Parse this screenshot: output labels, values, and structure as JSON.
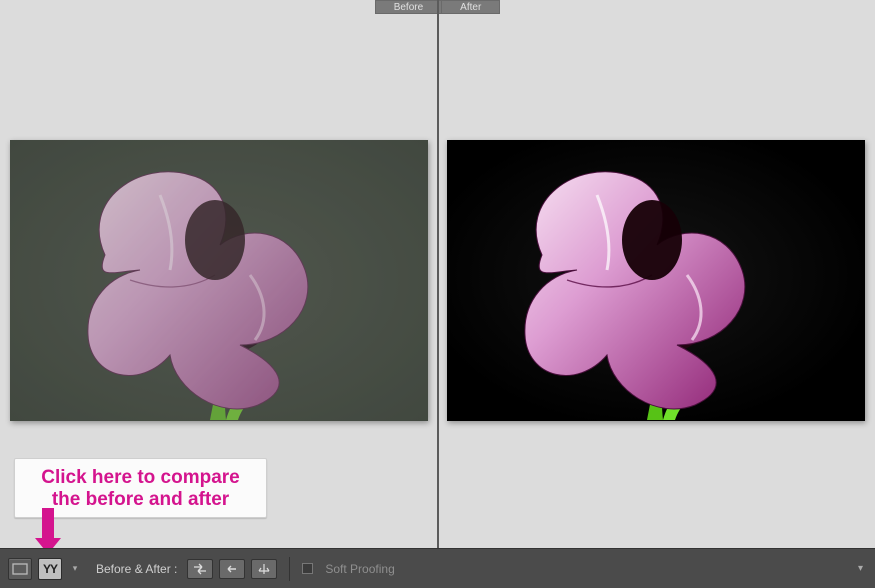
{
  "header": {
    "before": "Before",
    "after": "After"
  },
  "callout": "Click here to compare the before and after",
  "toolbar": {
    "loupe_icon": "loupe",
    "compare_label": "YY",
    "before_after_label": "Before & After :",
    "soft_proofing": "Soft Proofing"
  }
}
